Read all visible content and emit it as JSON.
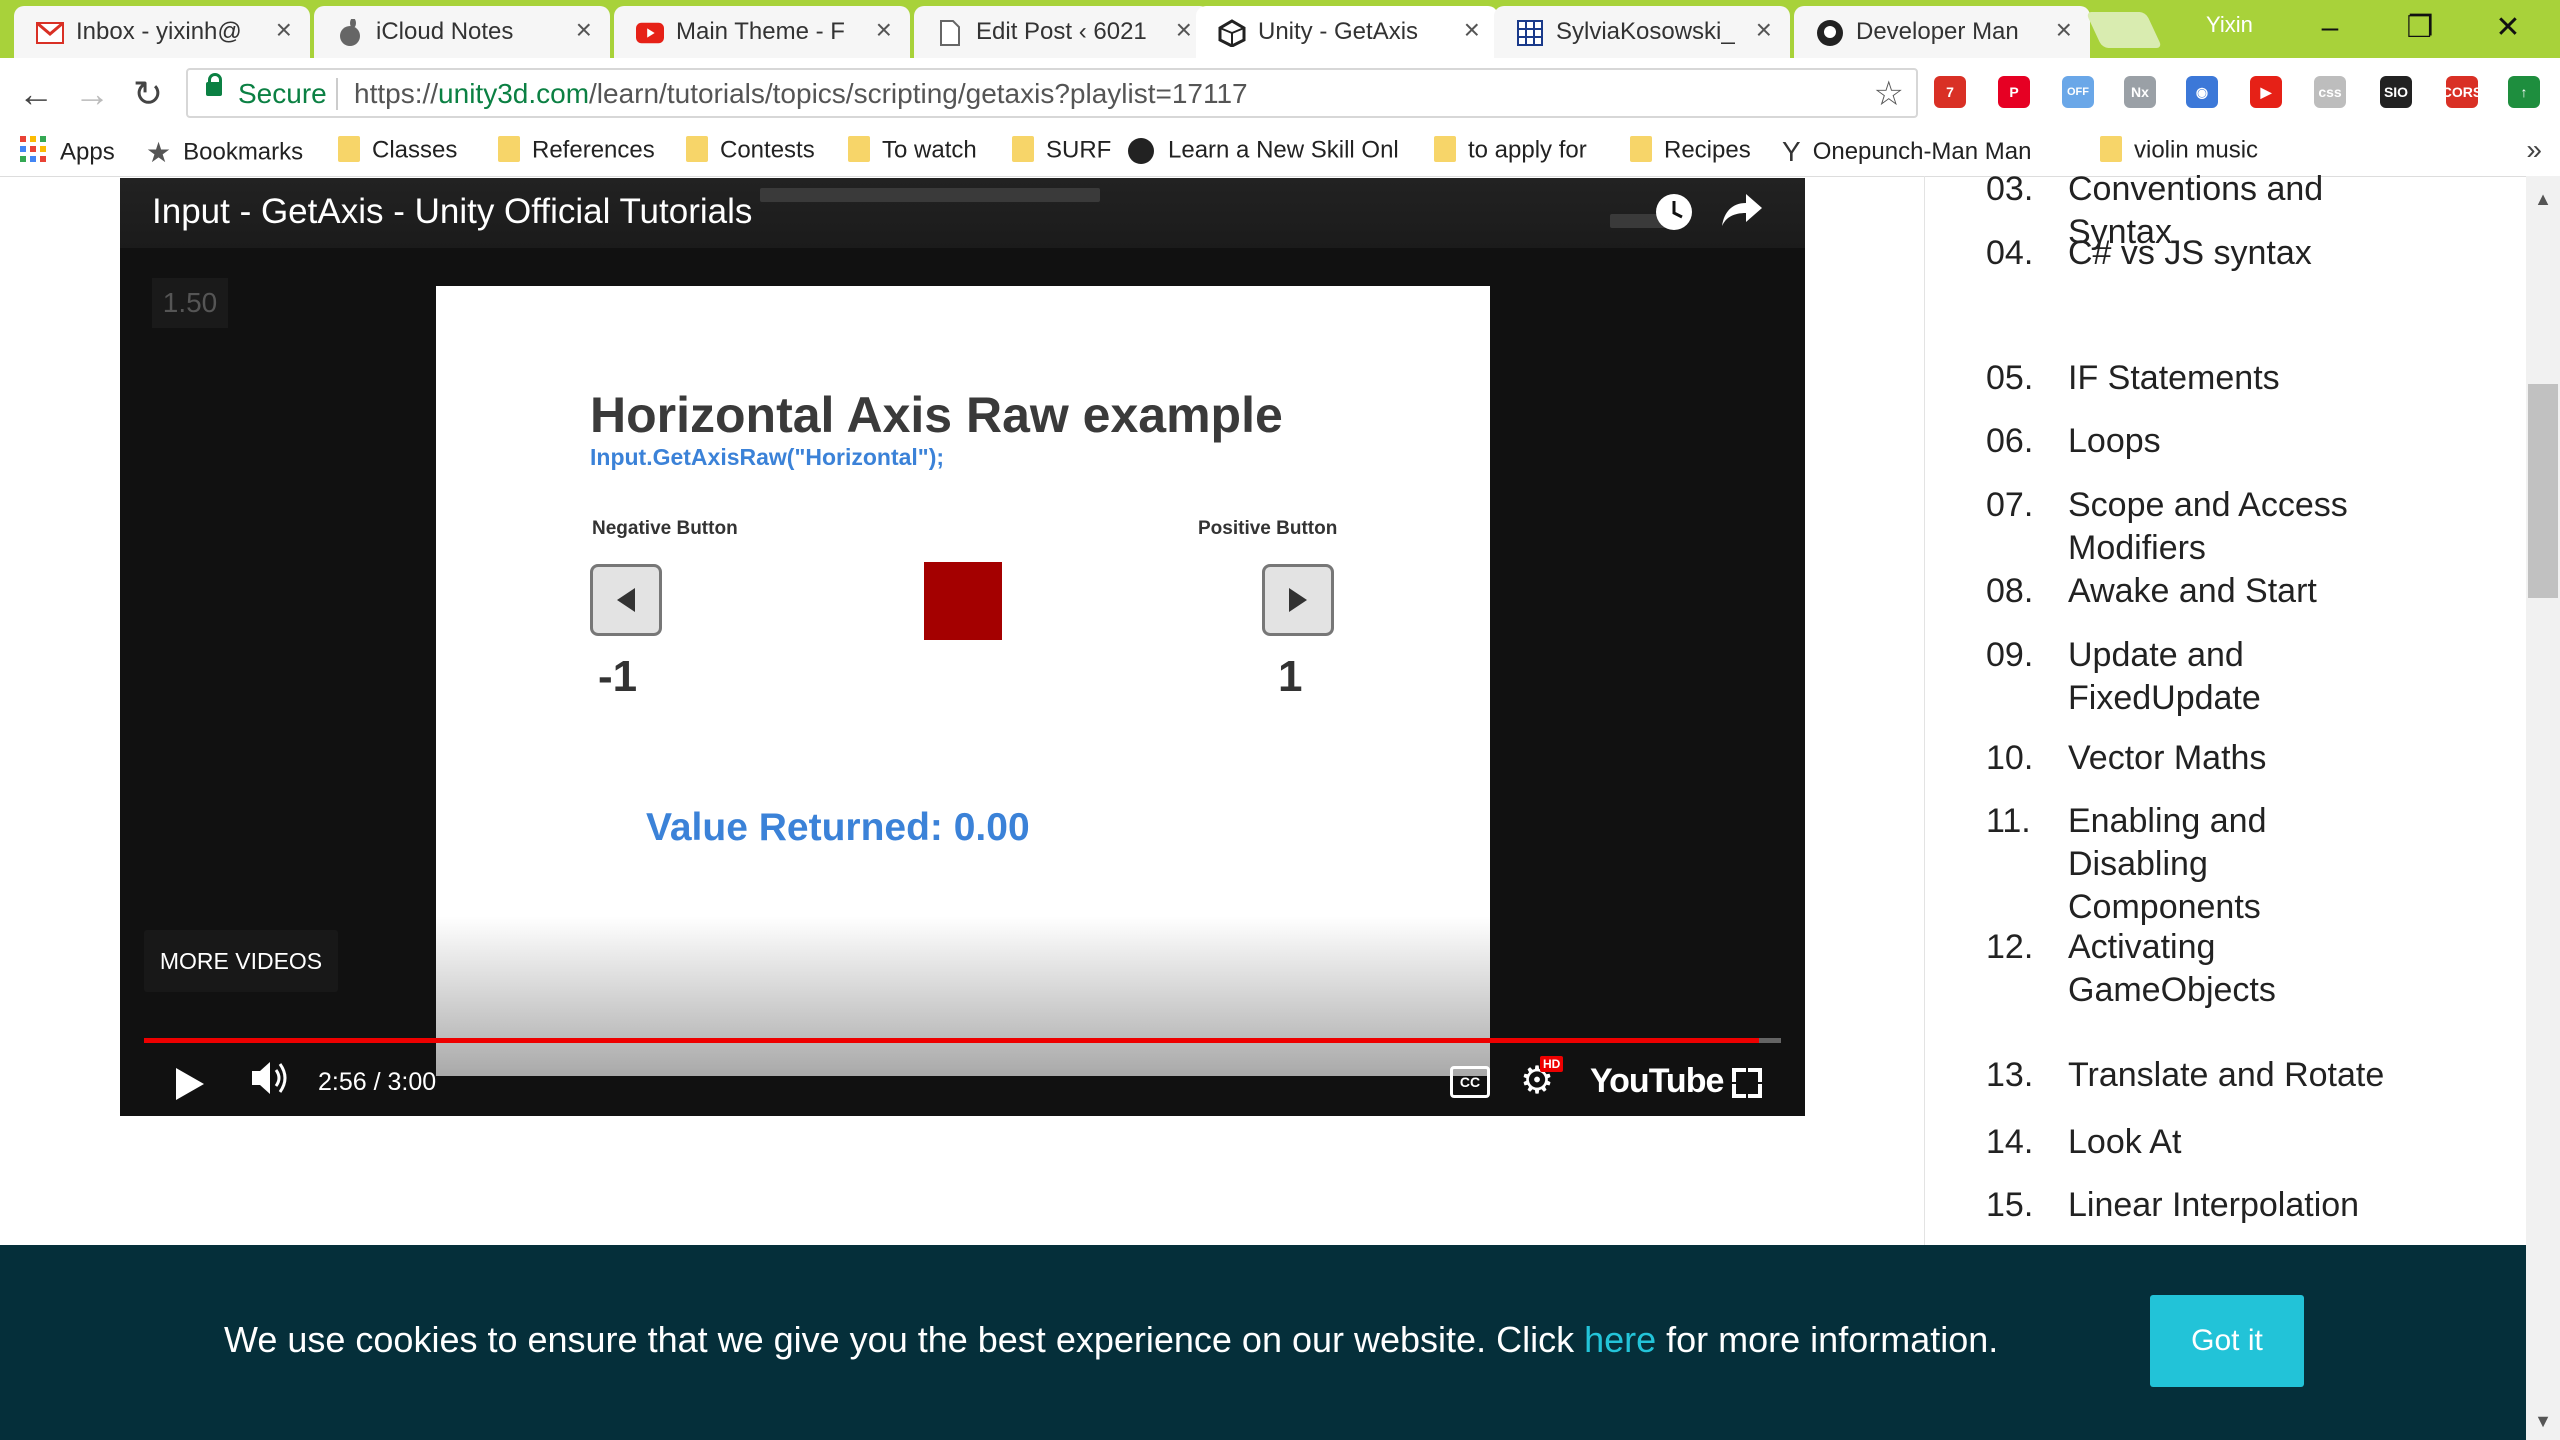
{
  "browser": {
    "tabs": [
      {
        "label": "Inbox - yixinh@",
        "icon": "gmail-icon"
      },
      {
        "label": "iCloud Notes",
        "icon": "apple-icon"
      },
      {
        "label": "Main Theme - F",
        "icon": "youtube-icon"
      },
      {
        "label": "Edit Post ‹ 6021",
        "icon": "document-icon"
      },
      {
        "label": "Unity - GetAxis",
        "icon": "unity-icon"
      },
      {
        "label": "SylviaKosowski_",
        "icon": "grid-icon"
      },
      {
        "label": "Developer Man",
        "icon": "github-icon"
      }
    ],
    "user": "Yixin",
    "secure_label": "Secure",
    "url_scheme": "https://",
    "url_host": "unity3d.com",
    "url_path": "/learn/tutorials/topics/scripting/getaxis?playlist=17117",
    "extensions": [
      {
        "name": "extension-badge-icon",
        "text": "7",
        "color": "#d93025"
      },
      {
        "name": "pinterest-icon",
        "text": "P",
        "color": "#e60023"
      },
      {
        "name": "extension-off-icon",
        "text": "OFF",
        "color": "#6aa7e8"
      },
      {
        "name": "nx-icon",
        "text": "Nx",
        "color": "#9aa0a6"
      },
      {
        "name": "globe-icon",
        "text": "◉",
        "color": "#3c78d8"
      },
      {
        "name": "youtube-ext-icon",
        "text": "▶",
        "color": "#e62117"
      },
      {
        "name": "css-icon",
        "text": "css",
        "color": "#bdbdbd"
      },
      {
        "name": "sio-icon",
        "text": "SIO",
        "color": "#222222"
      },
      {
        "name": "cors-icon",
        "text": "CORS",
        "color": "#d93025"
      },
      {
        "name": "upload-icon",
        "text": "↑",
        "color": "#1e8e3e"
      }
    ]
  },
  "bookmarks": [
    {
      "label": "Apps",
      "type": "apps"
    },
    {
      "label": "Bookmarks",
      "type": "star"
    },
    {
      "label": "Classes",
      "type": "folder"
    },
    {
      "label": "References",
      "type": "folder"
    },
    {
      "label": "Contests",
      "type": "folder"
    },
    {
      "label": "To watch",
      "type": "folder"
    },
    {
      "label": "SURF",
      "type": "folder"
    },
    {
      "label": "Learn a New Skill Onl",
      "type": "site"
    },
    {
      "label": "to apply for",
      "type": "folder"
    },
    {
      "label": "Recipes",
      "type": "folder"
    },
    {
      "label": "Onepunch-Man Man",
      "type": "site"
    },
    {
      "label": "violin music",
      "type": "folder"
    }
  ],
  "video": {
    "title": "Input - GetAxis - Unity Official Tutorials",
    "speed": "1.50",
    "slide": {
      "heading": "Horizontal Axis Raw example",
      "code": "Input.GetAxisRaw(\"Horizontal\");",
      "negative_label": "Negative Button",
      "positive_label": "Positive Button",
      "negative_value": "-1",
      "positive_value": "1",
      "value_returned": "Value Returned: 0.00"
    },
    "more_videos": "MORE VIDEOS",
    "time": "2:56 / 3:00",
    "progress": 0.9867,
    "youtube_logo": "YouTube",
    "cc": "CC",
    "hd": "HD"
  },
  "sidebar": {
    "lessons": [
      {
        "num": "03.",
        "title": "Conventions and Syntax"
      },
      {
        "num": "04.",
        "title": "C# vs JS syntax"
      },
      {
        "num": "05.",
        "title": "IF Statements"
      },
      {
        "num": "06.",
        "title": "Loops"
      },
      {
        "num": "07.",
        "title": "Scope and Access Modifiers"
      },
      {
        "num": "08.",
        "title": "Awake and Start"
      },
      {
        "num": "09.",
        "title": "Update and FixedUpdate"
      },
      {
        "num": "10.",
        "title": "Vector Maths"
      },
      {
        "num": "11.",
        "title": "Enabling and Disabling Components"
      },
      {
        "num": "12.",
        "title": "Activating GameObjects"
      },
      {
        "num": "13.",
        "title": "Translate and Rotate"
      },
      {
        "num": "14.",
        "title": "Look At"
      },
      {
        "num": "15.",
        "title": "Linear Interpolation"
      }
    ]
  },
  "cookie": {
    "text_before": "We use cookies to ensure that we give you the best experience on our website. Click ",
    "link": "here",
    "text_after": " for more information.",
    "button": "Got it"
  },
  "colors": {
    "tabstrip": "#a8d23a",
    "accent_blue": "#3b82d8",
    "cookie_bg": "#052f3a",
    "cookie_button": "#22c3d8",
    "progress": "#ee0000"
  }
}
